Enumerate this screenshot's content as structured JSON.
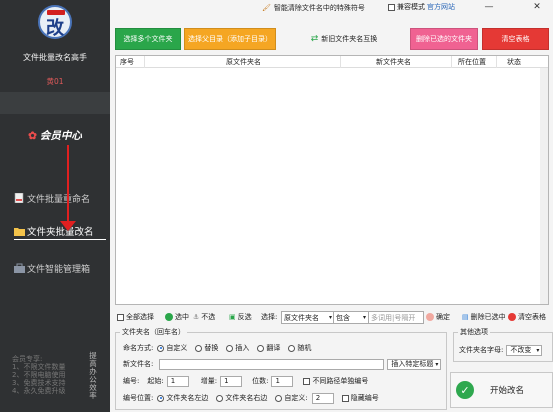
{
  "sidebar": {
    "app_title": "文件批量改名高手",
    "user_name": "黄01",
    "member_center": "会员中心",
    "nav": [
      {
        "label": "文件批量重命名"
      },
      {
        "label": "文件夹批量改名"
      },
      {
        "label": "文件智能管理箱"
      }
    ],
    "promo_lines": [
      "会员专享:",
      "1、不限文件数量",
      "2、不限电脑使用",
      "3、免费技术支持",
      "4、永久免费升级"
    ],
    "promo_vertical": "提高办公效率"
  },
  "topbar": {
    "smart_remove": "智能清除文件名中的特殊符号",
    "compat_mode": "兼容模式",
    "website": "官方网站",
    "minimize": "—",
    "close": "✕"
  },
  "toolbar": {
    "select_folders": "选择多个文件夹",
    "select_parent": "选择父目录（添加子目录）",
    "restore_names": "新旧文件夹名互换",
    "delete_selected": "删除已选的文件夹",
    "clear_table": "清空表格"
  },
  "table": {
    "columns": [
      "序号",
      "原文件夹名",
      "新文件夹名",
      "所在位置",
      "状态"
    ],
    "rows": []
  },
  "action_row": {
    "select_all": "全部选择",
    "select": "选中",
    "unselect": "不选",
    "invert": "反选",
    "choose_label": "选择:",
    "choose_value": "原文件夹名",
    "contains_value": "包含",
    "filter_placeholder": "多词用|号隔开",
    "confirm": "确定",
    "delete_dir": "删除已选中",
    "clear": "清空表格"
  },
  "folder_name_group": {
    "legend": "文件夹名（回车名）",
    "naming_label": "命名方式:",
    "naming_options": [
      "自定义",
      "替换",
      "插入",
      "翻译",
      "随机"
    ],
    "naming_selected": "自定义",
    "new_name_label": "新文件名:",
    "new_name_value": "",
    "insert_tag": "插入特定标题",
    "seq_label": "编号:",
    "start_label": "起始:",
    "start_value": "1",
    "inc_label": "增量:",
    "inc_value": "1",
    "digits_label": "位数:",
    "digits_value": "1",
    "diff_path": "不同路径单独编号",
    "pos_label": "编号位置:",
    "pos_options": [
      "文件夹名左边",
      "文件夹名右边",
      "自定义:"
    ],
    "pos_selected": "文件夹名左边",
    "custom_value": "2",
    "hide_seq": "隐藏编号"
  },
  "other_options": {
    "legend": "其他选项",
    "case_label": "文件夹名字母:",
    "case_value": "不改变"
  },
  "start_button": {
    "label": "开始改名",
    "icon": "check-icon"
  },
  "colors": {
    "sidebar_bg": "#2f3133",
    "green": "#2aa64a",
    "orange": "#f5a623",
    "pink": "#f06292",
    "red": "#e53935",
    "arrow_red": "#e02020"
  }
}
